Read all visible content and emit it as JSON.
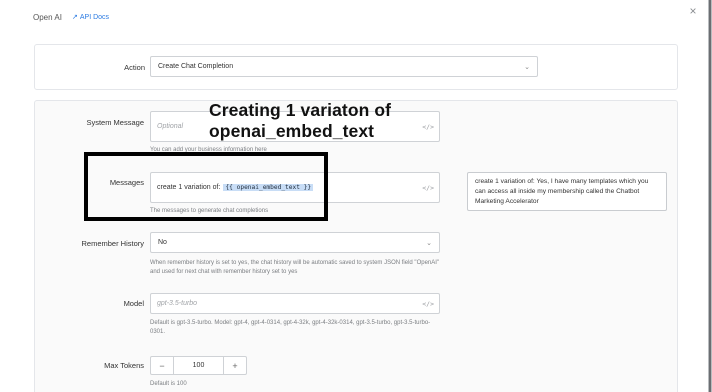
{
  "header": {
    "title": "Open AI",
    "api_docs_label": "API Docs",
    "close_glyph": "×"
  },
  "action": {
    "label": "Action",
    "value": "Create Chat Completion"
  },
  "system_message": {
    "label": "System Message",
    "placeholder": "Optional",
    "help": "You can add your business information here"
  },
  "messages": {
    "label": "Messages",
    "prefix": "create 1 variation of:",
    "chip": "{{ openai_embed_text }}",
    "help": "The messages to generate chat completions"
  },
  "preview": {
    "text": "create 1 variation of: Yes, I have many templates which you can access all inside my membership called the Chatbot Marketing Accelerator"
  },
  "remember_history": {
    "label": "Remember History",
    "value": "No",
    "help": "When remember history is set to yes, the chat history will be automatic saved to system JSON field \"OpenAI\" and used for next chat with remember history set to yes"
  },
  "model": {
    "label": "Model",
    "placeholder": "gpt-3.5-turbo",
    "help": "Default is gpt-3.5-turbo. Model: gpt-4, gpt-4-0314, gpt-4-32k, gpt-4-32k-0314, gpt-3.5-turbo, gpt-3.5-turbo-0301."
  },
  "max_tokens": {
    "label": "Max Tokens",
    "value": "100",
    "minus": "−",
    "plus": "+",
    "help": "Default is 100"
  },
  "overlay": {
    "line1": "Creating 1 variaton of",
    "line2": "openai_embed_text"
  },
  "icons": {
    "code": "</>",
    "chevron": "⌄",
    "external": "↗"
  },
  "colors": {
    "link": "#2a7ae2",
    "chip_bg": "#c8ddf6"
  }
}
